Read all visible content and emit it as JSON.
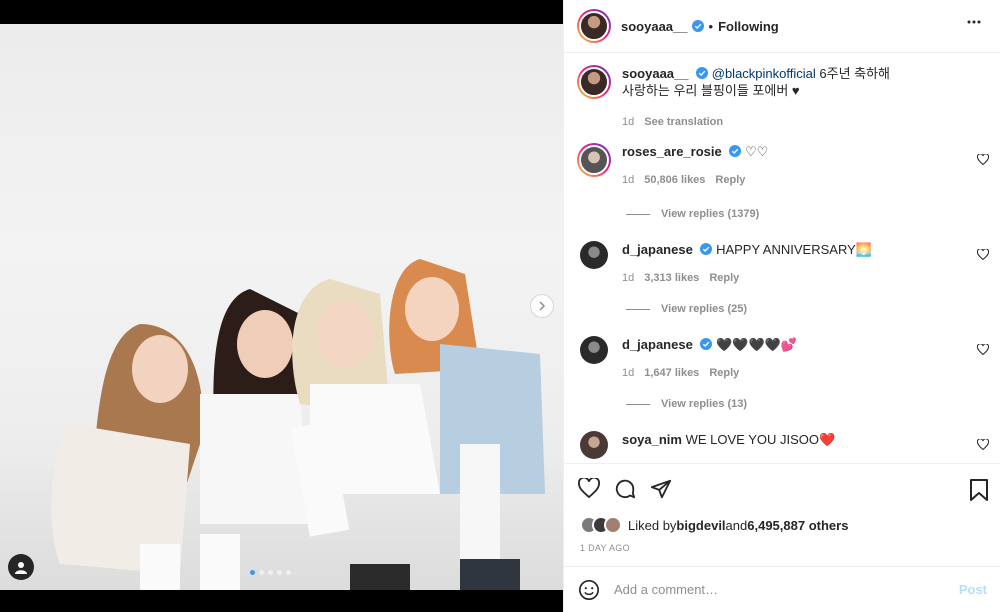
{
  "post": {
    "author": "sooyaaa__",
    "follow_sep": "•",
    "follow_status": "Following",
    "caption_mention": "@blackpinkofficial",
    "caption_text_1": " 6주년 축하해",
    "caption_text_2": "사랑하는 우리 블핑이들 포에버 ♥",
    "caption_time": "1d",
    "caption_translate": "See translation"
  },
  "comments": [
    {
      "user": "roses_are_rosie",
      "text": "♡♡",
      "time": "1d",
      "likes": "50,806 likes",
      "reply": "Reply",
      "view_replies": "View replies (1379)"
    },
    {
      "user": "d_japanese",
      "text": "HAPPY ANNIVERSARY🌅",
      "time": "1d",
      "likes": "3,313 likes",
      "reply": "Reply",
      "view_replies": "View replies (25)"
    },
    {
      "user": "d_japanese",
      "text": "🖤🖤🖤🖤💕",
      "time": "1d",
      "likes": "1,647 likes",
      "reply": "Reply",
      "view_replies": "View replies (13)"
    },
    {
      "user": "soya_nim",
      "text": "WE LOVE YOU JISOO❤️"
    }
  ],
  "likes_summary": {
    "prefix": "Liked by ",
    "user": "bigdevil",
    "and": " and ",
    "others": "6,495,887 others"
  },
  "timestamp": "1 DAY AGO",
  "composer": {
    "placeholder": "Add a comment…",
    "post_label": "Post"
  },
  "colors": {
    "verified": "#3897f0",
    "post_disabled": "#b2dffc",
    "meta_gray": "#8e8e8e"
  },
  "icons": [
    "more-icon",
    "heart-icon",
    "comment-icon",
    "share-icon",
    "bookmark-icon",
    "emoji-icon",
    "chevron-right-icon",
    "user-tag-icon",
    "verified-icon"
  ]
}
